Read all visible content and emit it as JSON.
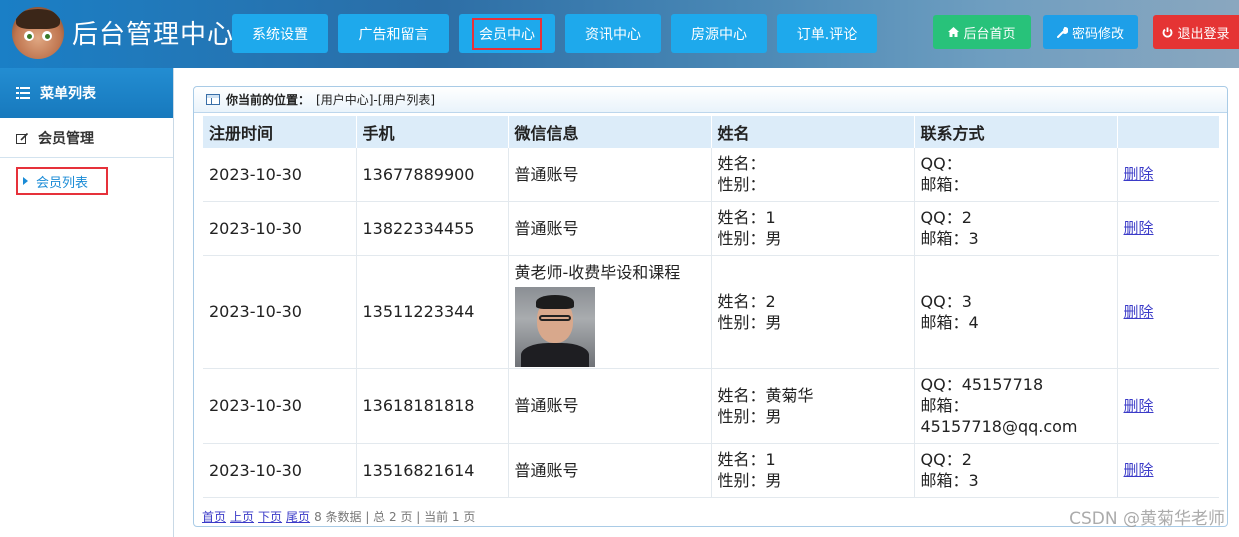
{
  "header": {
    "title": "后台管理中心",
    "nav": [
      {
        "label": "系统设置"
      },
      {
        "label": "广告和留言"
      },
      {
        "label": "会员中心"
      },
      {
        "label": "资讯中心"
      },
      {
        "label": "房源中心"
      },
      {
        "label": "订单.评论"
      }
    ],
    "tools": {
      "home": "后台首页",
      "password": "密码修改",
      "logout": "退出登录"
    },
    "colors": {
      "nav": "#1ea9ec",
      "home": "#28c27a",
      "password": "#1e9fe8",
      "logout": "#e53434",
      "highlight": "#e6313a"
    }
  },
  "sidebar": {
    "title": "菜单列表",
    "group": "会员管理",
    "item": "会员列表"
  },
  "breadcrumb": {
    "label": "你当前的位置：",
    "path": "[用户中心]-[用户列表]"
  },
  "table": {
    "columns": [
      "注册时间",
      "手机",
      "微信信息",
      "姓名",
      "联系方式",
      ""
    ],
    "rows": [
      {
        "date": "2023-10-30",
        "phone": "13677889900",
        "wechat": "普通账号",
        "name": "姓名：",
        "gender": "性别：",
        "qq": "QQ：",
        "email": "邮箱：",
        "action": "删除"
      },
      {
        "date": "2023-10-30",
        "phone": "13822334455",
        "wechat": "普通账号",
        "name": "姓名：1",
        "gender": "性别：男",
        "qq": "QQ：2",
        "email": "邮箱：3",
        "action": "删除"
      },
      {
        "date": "2023-10-30",
        "phone": "13511223344",
        "wechat": "黄老师-收费毕设和课程",
        "name": "姓名：2",
        "gender": "性别：男",
        "qq": "QQ：3",
        "email": "邮箱：4",
        "action": "删除"
      },
      {
        "date": "2023-10-30",
        "phone": "13618181818",
        "wechat": "普通账号",
        "name": "姓名：黄菊华",
        "gender": "性别：男",
        "qq": "QQ：45157718",
        "email": "邮箱：",
        "email2": "45157718@qq.com",
        "action": "删除"
      },
      {
        "date": "2023-10-30",
        "phone": "13516821614",
        "wechat": "普通账号",
        "name": "姓名：1",
        "gender": "性别：男",
        "qq": "QQ：2",
        "email": "邮箱：3",
        "action": "删除"
      }
    ]
  },
  "pager": {
    "first": "首页",
    "prev": "上页",
    "next": "下页",
    "last": "尾页",
    "info": "8 条数据 | 总 2 页 | 当前 1 页"
  },
  "watermark": "CSDN @黄菊华老师"
}
